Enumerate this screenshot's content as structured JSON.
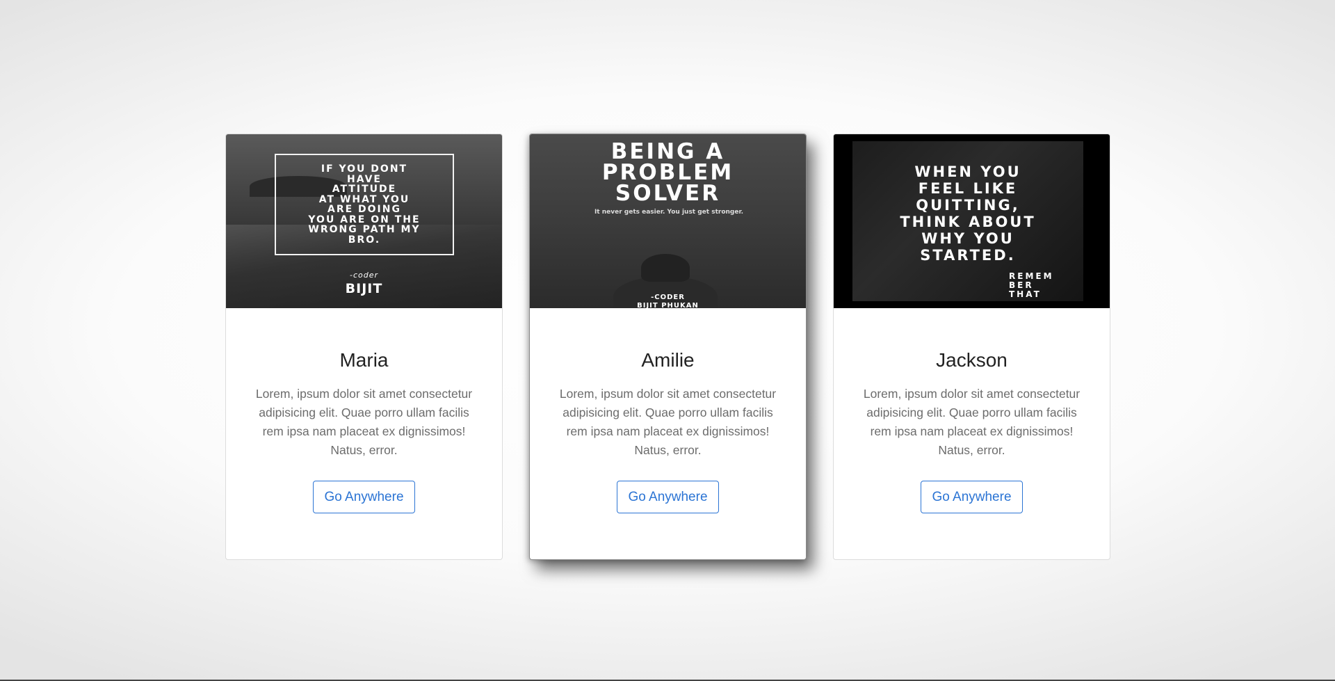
{
  "cards": [
    {
      "poster": {
        "lines": [
          "IF YOU DONT",
          "HAVE",
          "ATTITUDE",
          "AT WHAT YOU",
          "ARE DOING",
          "YOU ARE ON THE",
          "WRONG PATH MY",
          "BRO."
        ],
        "signature_small": "-coder",
        "signature_name": "BIJIT"
      },
      "title": "Maria",
      "text": "Lorem, ipsum dolor sit amet consectetur adipisicing elit. Quae porro ullam facilis rem ipsa nam placeat ex dignissimos! Natus, error.",
      "button_label": "Go Anywhere"
    },
    {
      "poster": {
        "headline": [
          "BEING A",
          "PROBLEM",
          "SOLVER"
        ],
        "subtitle": "It never gets easier. You just get stronger.",
        "credit_role": "-CODER",
        "credit_name": "BIJIT PHUKAN"
      },
      "title": "Amilie",
      "text": "Lorem, ipsum dolor sit amet consectetur adipisicing elit. Quae porro ullam facilis rem ipsa nam placeat ex dignissimos! Natus, error.",
      "button_label": "Go Anywhere"
    },
    {
      "poster": {
        "headline": [
          "WHEN YOU",
          "FEEL LIKE",
          "QUITTING,",
          "THINK ABOUT",
          "WHY YOU",
          "STARTED."
        ],
        "tag": [
          "REMEM",
          "BER",
          "THAT"
        ]
      },
      "title": "Jackson",
      "text": "Lorem, ipsum dolor sit amet consectetur adipisicing elit. Quae porro ullam facilis rem ipsa nam placeat ex dignissimos! Natus, error.",
      "button_label": "Go Anywhere"
    }
  ]
}
